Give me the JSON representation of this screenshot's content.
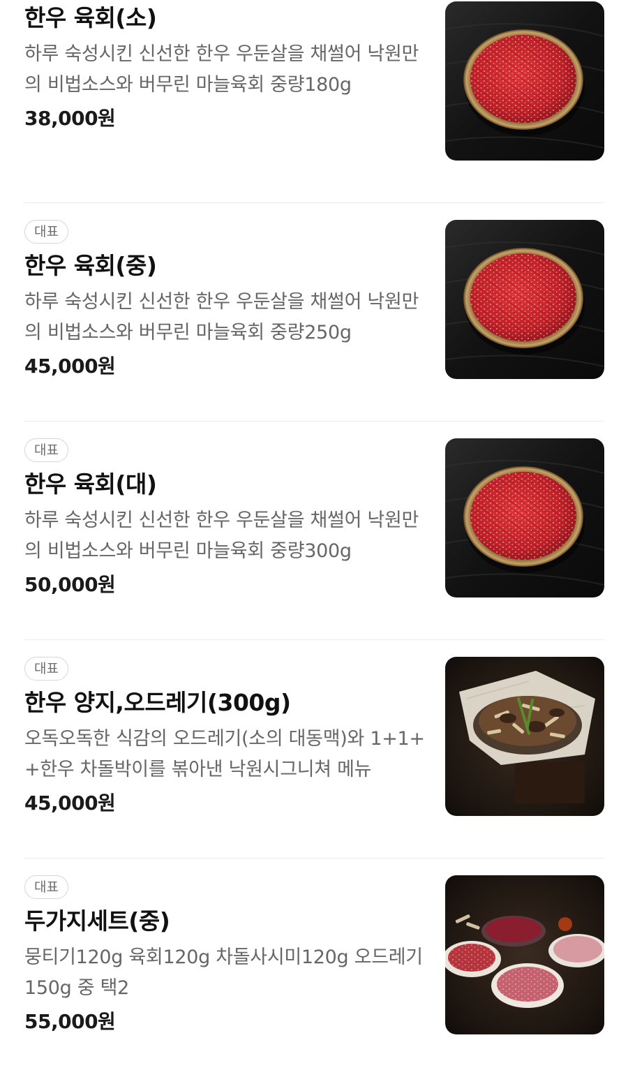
{
  "menu": {
    "items": [
      {
        "badge": "",
        "name": "한우 육회(소)",
        "description": "하루 숙성시킨 신선한 한우 우둔살을 채썰어 낙원만의 비법소스와 버무린 마늘육회 중량180g",
        "price": "38,000원",
        "image": "yukhoe-plate-icon"
      },
      {
        "badge": "대표",
        "name": "한우 육회(중)",
        "description": "하루 숙성시킨 신선한 한우 우둔살을 채썰어 낙원만의 비법소스와 버무린 마늘육회 중량250g",
        "price": "45,000원",
        "image": "yukhoe-plate-icon"
      },
      {
        "badge": "대표",
        "name": "한우 육회(대)",
        "description": "하루 숙성시킨 신선한 한우 우둔살을 채썰어 낙원만의 비법소스와 버무린 마늘육회 중량300g",
        "price": "50,000원",
        "image": "yukhoe-plate-icon"
      },
      {
        "badge": "대표",
        "name": "한우 양지,오드레기(300g)",
        "description": "오독오독한 식감의 오드레기(소의 대동맥)와 1+1++한우 차돌박이를 볶아낸 낙원시그니쳐 메뉴",
        "price": "45,000원",
        "image": "stir-fry-dish-icon"
      },
      {
        "badge": "대표",
        "name": "두가지세트(중)",
        "description": "뭉티기120g 육회120g 차돌사시미120g 오드레기150g 중 택2",
        "price": "55,000원",
        "image": "set-platter-icon"
      }
    ]
  },
  "colors": {
    "text_primary": "#111111",
    "text_secondary": "#666666",
    "badge_border": "#d6d6d6",
    "divider": "#ececec",
    "meat_red": "#c8262b"
  }
}
